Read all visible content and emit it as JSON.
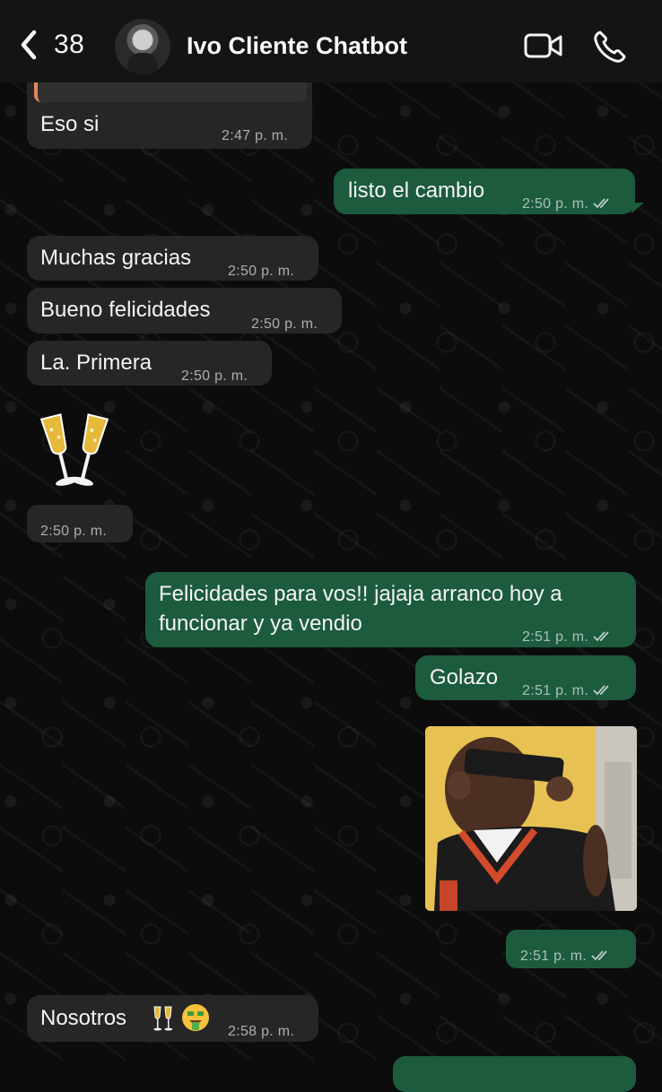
{
  "header": {
    "back_count": "38",
    "contact_name": "Ivo Cliente Chatbot",
    "icons": [
      "chevron-left-icon",
      "video-call-icon",
      "phone-icon"
    ]
  },
  "colors": {
    "incoming_bubble": "#262626",
    "outgoing_bubble": "#1c5b3e",
    "header_bg": "#141414",
    "wallpaper": "#0c0c0c"
  },
  "messages": [
    {
      "text": "Eso si",
      "time": "2:47 p. m.",
      "direction": "in"
    },
    {
      "text": "listo el cambio",
      "time": "2:50 p. m.",
      "direction": "out",
      "read": true
    },
    {
      "text": "Muchas gracias",
      "time": "2:50 p. m.",
      "direction": "in"
    },
    {
      "text": "Bueno felicidades",
      "time": "2:50 p. m.",
      "direction": "in"
    },
    {
      "text": "La. Primera",
      "time": "2:50 p. m.",
      "direction": "in"
    },
    {
      "text": "",
      "emoji": "clinking-glasses",
      "time": "2:50 p. m.",
      "direction": "in"
    },
    {
      "text": "Felicidades para vos!! jajaja arranco hoy a funcionar y ya vendio",
      "line1": "Felicidades para vos!! jajaja arranco hoy a",
      "line2": "funcionar y ya vendio",
      "time": "2:51 p. m.",
      "direction": "out",
      "read": true
    },
    {
      "text": "Golazo",
      "time": "2:51 p. m.",
      "direction": "out",
      "read": true
    },
    {
      "text": "",
      "media": "photo",
      "time": "2:51 p. m.",
      "direction": "out",
      "read": true
    },
    {
      "text": "Nosotros",
      "emoji_suffix": "clinking-glasses, money-mouth-face",
      "time": "2:58 p. m.",
      "direction": "in"
    }
  ]
}
